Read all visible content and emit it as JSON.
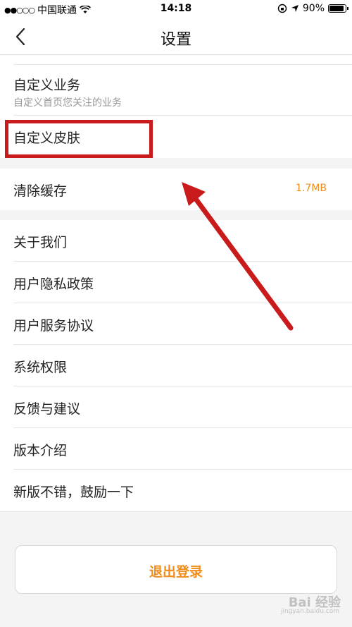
{
  "status_bar": {
    "signal": "●●○○○",
    "carrier": "中国联通",
    "time": "14:18",
    "battery": "90%"
  },
  "nav": {
    "title": "设置"
  },
  "rows_top": [
    {
      "label": "自定义业务",
      "subtitle": "自定义首页您关注的业务"
    },
    {
      "label": "自定义皮肤"
    }
  ],
  "cache_row": {
    "label": "清除缓存",
    "value": "1.7MB"
  },
  "rows_bottom": [
    {
      "label": "关于我们"
    },
    {
      "label": "用户隐私政策"
    },
    {
      "label": "用户服务协议"
    },
    {
      "label": "系统权限"
    },
    {
      "label": "反馈与建议"
    },
    {
      "label": "版本介绍"
    },
    {
      "label": "新版不错，鼓励一下"
    }
  ],
  "logout": {
    "label": "退出登录"
  },
  "watermark": {
    "text": "Bai 经验",
    "url": "jingyan.baidu.com"
  },
  "colors": {
    "accent": "#f08c1a",
    "annotation": "#c91b1b"
  }
}
